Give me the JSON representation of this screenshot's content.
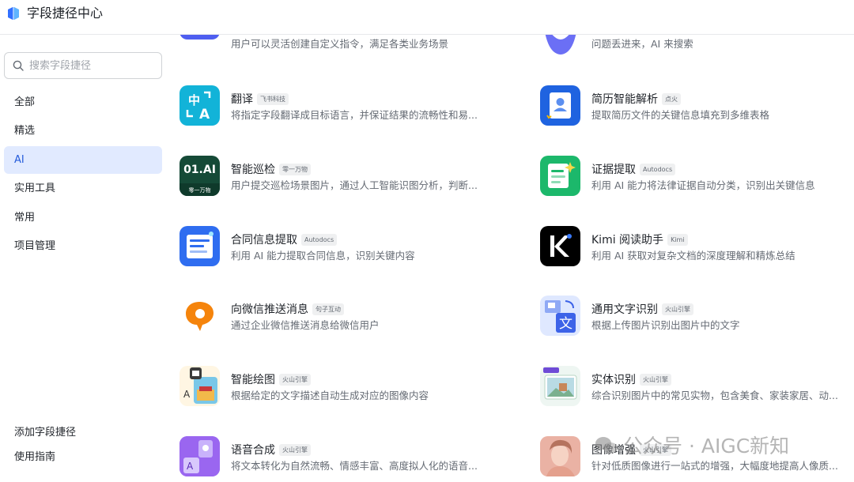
{
  "app": {
    "title": "字段捷径中心"
  },
  "search": {
    "placeholder": "搜索字段捷径"
  },
  "nav": {
    "items": [
      {
        "label": "全部"
      },
      {
        "label": "精选"
      },
      {
        "label": "AI",
        "active": true
      },
      {
        "label": "实用工具"
      },
      {
        "label": "常用"
      },
      {
        "label": "项目管理"
      }
    ],
    "bottom": [
      {
        "label": "添加字段捷径"
      },
      {
        "label": "使用指南"
      }
    ]
  },
  "cards": [
    {
      "title": "",
      "tag": "",
      "desc": "用户可以灵活创建自定义指令，满足各类业务场景",
      "icon": "custom-command-icon"
    },
    {
      "title": "",
      "tag": "",
      "desc": "问题丢进来，AI 来搜索",
      "icon": "ai-search-icon"
    },
    {
      "title": "翻译",
      "tag": "飞书科技",
      "desc": "将指定字段翻译成目标语言，并保证结果的流畅性和易...",
      "icon": "translate-icon"
    },
    {
      "title": "简历智能解析",
      "tag": "点火",
      "desc": "提取简历文件的关键信息填充到多维表格",
      "icon": "resume-icon"
    },
    {
      "title": "智能巡检",
      "tag": "零一万物",
      "desc": "用户提交巡检场景图片，通过人工智能识图分析，判断...",
      "icon": "01ai-icon",
      "icon_text": "01.AI",
      "icon_sub": "零一万物"
    },
    {
      "title": "证据提取",
      "tag": "Autodocs",
      "desc": "利用 AI 能力将法律证据自动分类，识别出关键信息",
      "icon": "evidence-icon"
    },
    {
      "title": "合同信息提取",
      "tag": "Autodocs",
      "desc": "利用 AI 能力提取合同信息，识别关键内容",
      "icon": "contract-icon"
    },
    {
      "title": "Kimi 阅读助手",
      "tag": "Kimi",
      "desc": "利用 AI 获取对复杂文档的深度理解和精炼总结",
      "icon": "kimi-icon"
    },
    {
      "title": "向微信推送消息",
      "tag": "句子互动",
      "desc": "通过企业微信推送消息给微信用户",
      "icon": "wechat-push-icon"
    },
    {
      "title": "通用文字识别",
      "tag": "火山引擎",
      "desc": "根据上传图片识别出图片中的文字",
      "icon": "ocr-icon",
      "icon_text": "文"
    },
    {
      "title": "智能绘图",
      "tag": "火山引擎",
      "desc": "根据给定的文字描述自动生成对应的图像内容",
      "icon": "ai-draw-icon"
    },
    {
      "title": "实体识别",
      "tag": "火山引擎",
      "desc": "综合识别图片中的常见实物，包含美食、家装家居、动...",
      "icon": "entity-icon"
    },
    {
      "title": "语音合成",
      "tag": "火山引擎",
      "desc": "将文本转化为自然流畅、情感丰富、高度拟人化的语音...",
      "icon": "tts-icon"
    },
    {
      "title": "图像增强",
      "tag": "火山引擎",
      "desc": "针对低质图像进行一站式的增强，大幅度地提高人像质...",
      "icon": "image-enhance-icon"
    }
  ],
  "watermark": {
    "text": "公众号 · AIGC新知"
  },
  "colors": {
    "accent": "#245bdb",
    "active_bg": "#e1eaff"
  }
}
